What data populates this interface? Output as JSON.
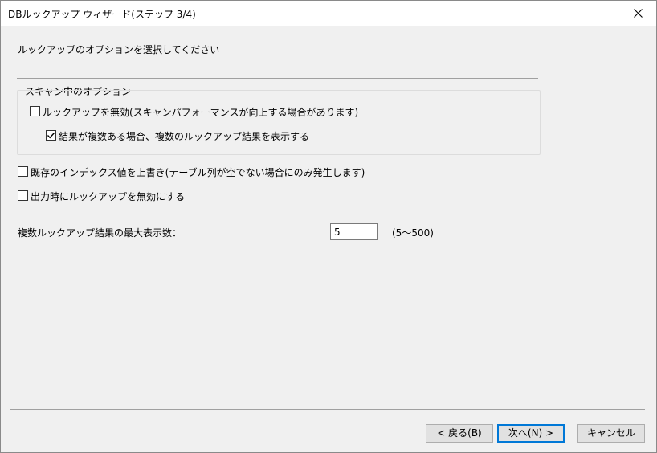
{
  "window": {
    "title": "DBルックアップ ウィザード(ステップ 3/4)"
  },
  "instruction": "ルックアップのオプションを選択してください",
  "scan_group": {
    "label": "スキャン中のオプション",
    "disable_lookup": {
      "label": "ルックアップを無効(スキャンパフォーマンスが向上する場合があります)",
      "checked": false
    },
    "show_multiple": {
      "label": "結果が複数ある場合、複数のルックアップ結果を表示する",
      "checked": true
    }
  },
  "overwrite_index": {
    "label": "既存のインデックス値を上書き(テーブル列が空でない場合にのみ発生します)",
    "checked": false
  },
  "disable_on_output": {
    "label": "出力時にルックアップを無効にする",
    "checked": false
  },
  "max_results": {
    "label": "複数ルックアップ結果の最大表示数：",
    "value": "5",
    "range": "(5～500)"
  },
  "buttons": {
    "back": "< 戻る(B)",
    "next": "次へ(N) >",
    "cancel": "キャンセル"
  },
  "icons": {
    "close": "close-icon",
    "check": "checkmark-icon"
  }
}
